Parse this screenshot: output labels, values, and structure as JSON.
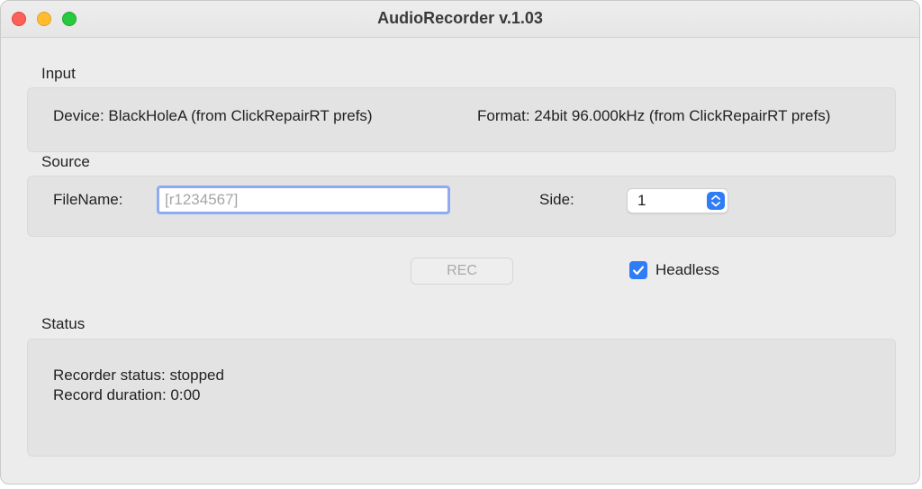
{
  "window": {
    "title": "AudioRecorder v.1.03"
  },
  "input_section": {
    "label": "Input",
    "device_text": "Device: BlackHoleA (from ClickRepairRT prefs)",
    "format_text": "Format: 24bit 96.000kHz (from ClickRepairRT prefs)"
  },
  "source_section": {
    "label": "Source",
    "filename_label": "FileName:",
    "filename_value": "",
    "filename_placeholder": "[r1234567]",
    "side_label": "Side:",
    "side_value": "1"
  },
  "controls": {
    "rec_label": "REC",
    "headless_label": "Headless",
    "headless_checked": true
  },
  "status_section": {
    "label": "Status",
    "recorder_status": "Recorder status: stopped",
    "record_duration": "Record duration: 0:00"
  },
  "colors": {
    "accent": "#2f7df6",
    "close": "#fe5f57",
    "minimize": "#febc2e",
    "maximize": "#28c840"
  },
  "icons": {
    "stepper": "up-down-chevrons-icon",
    "checkbox": "checkmark-icon"
  }
}
